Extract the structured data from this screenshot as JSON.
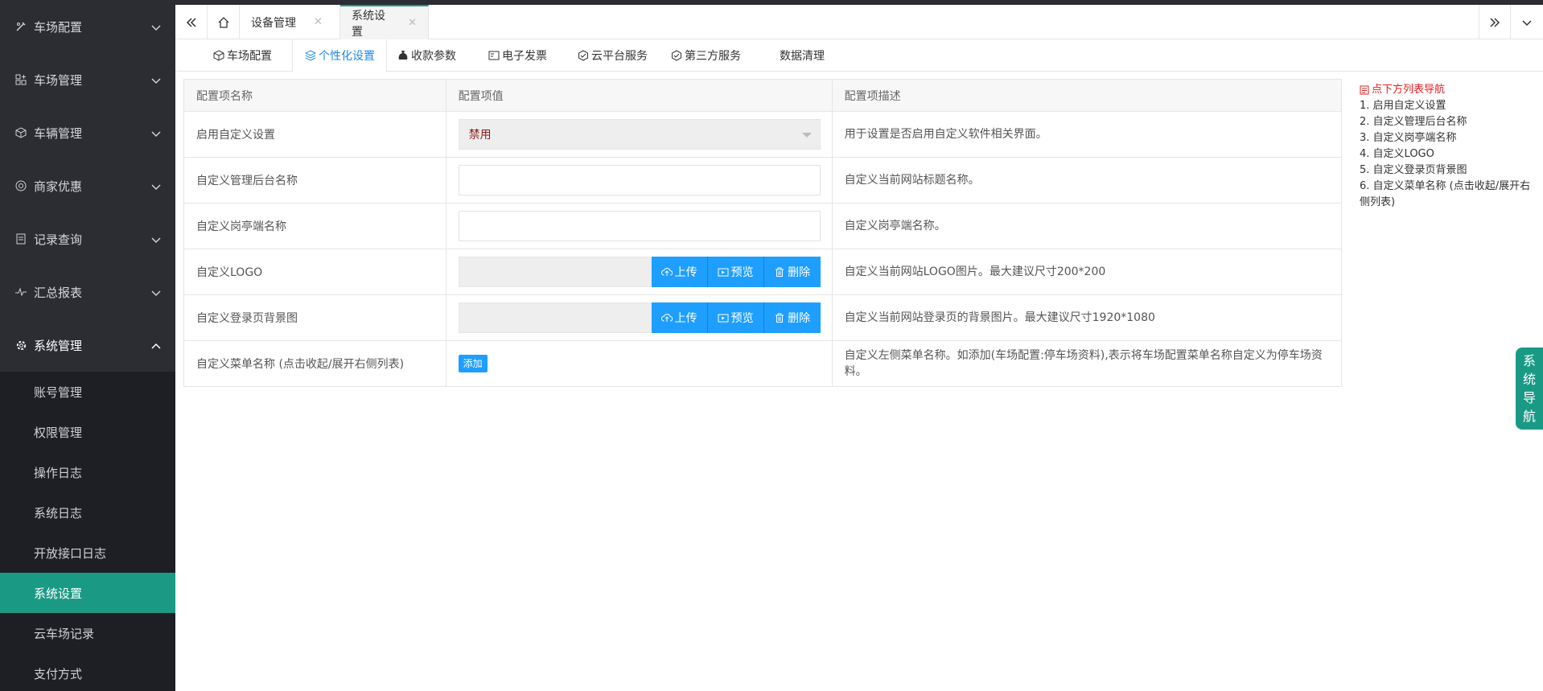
{
  "sidebar": {
    "menus": [
      {
        "label": "车场配置",
        "icon": "wrench-icon"
      },
      {
        "label": "车场管理",
        "icon": "grid-plus-icon"
      },
      {
        "label": "车辆管理",
        "icon": "cube-icon"
      },
      {
        "label": "商家优惠",
        "icon": "gear-circle-icon"
      },
      {
        "label": "记录查询",
        "icon": "document-icon"
      },
      {
        "label": "汇总报表",
        "icon": "pulse-icon"
      },
      {
        "label": "系统管理",
        "icon": "gear-icon"
      }
    ],
    "submenu": [
      "账号管理",
      "权限管理",
      "操作日志",
      "系统日志",
      "开放接口日志",
      "系统设置",
      "云车场记录",
      "支付方式"
    ]
  },
  "tabs": [
    {
      "label": "设备管理"
    },
    {
      "label": "系统设置"
    }
  ],
  "subtabs": [
    {
      "label": "车场配置",
      "icon": "cube-icon"
    },
    {
      "label": "个性化设置",
      "icon": "layers-icon"
    },
    {
      "label": "收款参数",
      "icon": "money-bag-icon"
    },
    {
      "label": "电子发票",
      "icon": "card-icon"
    },
    {
      "label": "云平台服务",
      "icon": "hex-icon"
    },
    {
      "label": "第三方服务",
      "icon": "hex-icon"
    },
    {
      "label": "数据清理",
      "icon": ""
    }
  ],
  "table": {
    "headers": [
      "配置项名称",
      "配置项值",
      "配置项描述"
    ],
    "rows": [
      {
        "name": "启用自定义设置",
        "value": "禁用",
        "desc": "用于设置是否启用自定义软件相关界面。"
      },
      {
        "name": "自定义管理后台名称",
        "value": "",
        "desc": "自定义当前网站标题名称。"
      },
      {
        "name": "自定义岗亭端名称",
        "value": "",
        "desc": "自定义岗亭端名称。"
      },
      {
        "name": "自定义LOGO",
        "value": "",
        "desc": "自定义当前网站LOGO图片。最大建议尺寸200*200"
      },
      {
        "name": "自定义登录页背景图",
        "value": "",
        "desc": "自定义当前网站登录页的背景图片。最大建议尺寸1920*1080"
      },
      {
        "name": "自定义菜单名称 (点击收起/展开右侧列表)",
        "value": "",
        "desc": "自定义左侧菜单名称。如添加(车场配置:停车场资料),表示将车场配置菜单名称自定义为停车场资料。"
      }
    ],
    "upload_labels": {
      "upload": "上传",
      "preview": "预览",
      "delete": "删除"
    },
    "add_label": "添加"
  },
  "right_nav": {
    "title": "点下方列表导航",
    "items": [
      "1. 启用自定义设置",
      "2. 自定义管理后台名称",
      "3. 自定义岗亭端名称",
      "4. 自定义LOGO",
      "5. 自定义登录页背景图",
      "6. 自定义菜单名称 (点击收起/展开右侧列表)"
    ]
  },
  "sys_nav_btn": [
    "系",
    "统",
    "导",
    "航"
  ],
  "colors": {
    "accent": "#1a9a85",
    "primary_button": "#1e9fff",
    "active_subtab": "#1e88e5",
    "sidebar_bg": "#2b2d33"
  }
}
